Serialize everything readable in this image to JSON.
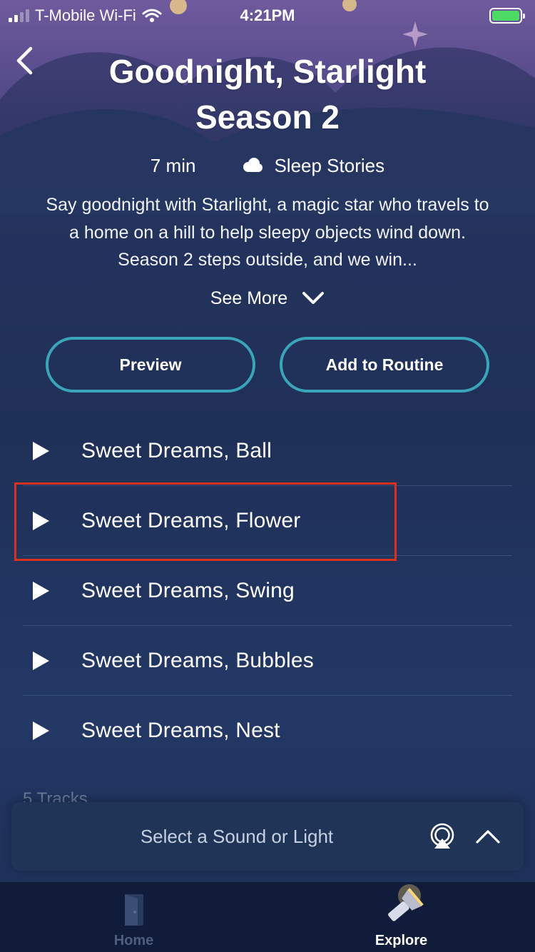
{
  "status_bar": {
    "carrier": "T-Mobile Wi-Fi",
    "time": "4:21PM",
    "battery_color": "#4cd964"
  },
  "header": {
    "back_icon": "chevron-left-icon",
    "title": "Goodnight, Starlight Season 2"
  },
  "meta": {
    "duration": "7 min",
    "category": "Sleep Stories",
    "category_icon": "cloud-icon"
  },
  "description": "Say goodnight with Starlight, a magic star who travels to a home on a hill to help sleepy objects wind down. Season 2 steps outside, and we win...",
  "see_more": {
    "label": "See More",
    "icon": "chevron-down-icon"
  },
  "actions": {
    "preview_label": "Preview",
    "add_routine_label": "Add to Routine",
    "accent_color": "#3aa5b8"
  },
  "tracks": [
    {
      "name": "Sweet Dreams, Ball"
    },
    {
      "name": "Sweet Dreams, Flower"
    },
    {
      "name": "Sweet Dreams, Swing"
    },
    {
      "name": "Sweet Dreams, Bubbles"
    },
    {
      "name": "Sweet Dreams, Nest"
    }
  ],
  "highlight_color": "#d8311e",
  "tracks_count": "5 Tracks",
  "player": {
    "label": "Select a Sound or Light",
    "airplay_icon": "airplay-icon",
    "expand_icon": "chevron-up-icon"
  },
  "tab_bar": {
    "home_label": "Home",
    "explore_label": "Explore",
    "active_tab": "Explore"
  }
}
